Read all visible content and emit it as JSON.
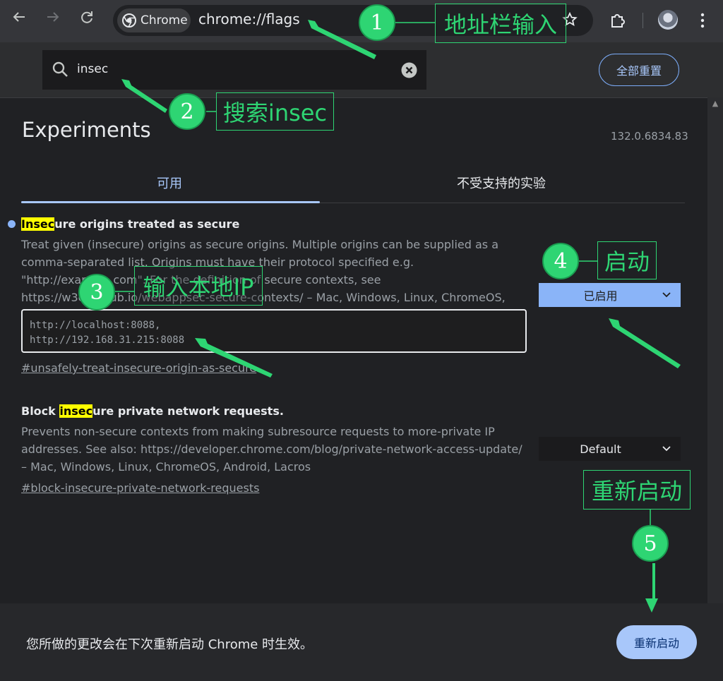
{
  "browser": {
    "chip_label": "Chrome",
    "url": "chrome://flags"
  },
  "search": {
    "query": "insec"
  },
  "header": {
    "reset_label": "全部重置"
  },
  "main": {
    "title": "Experiments",
    "version": "132.0.6834.83",
    "tabs": [
      {
        "label": "可用"
      },
      {
        "label": "不受支持的实验"
      }
    ]
  },
  "flags": [
    {
      "title_highlight": "Insec",
      "title_rest": "ure origins treated as secure",
      "description": "Treat given (insecure) origins as secure origins. Multiple origins can be supplied as a comma-separated list. Origins must have their protocol specified e.g. \"http://example.com\". For the definition of secure contexts, see https://w3c.github.io/webappsec-secure-contexts/ – Mac, Windows, Linux, ChromeOS, Android, Lacros",
      "textarea_value": "http://localhost:8088,\nhttp://192.168.31.215:8088",
      "link": "#unsafely-treat-insecure-origin-as-secure",
      "select_value": "已启用"
    },
    {
      "title_pre": "Block ",
      "title_highlight": "insec",
      "title_rest": "ure private network requests.",
      "description": "Prevents non-secure contexts from making subresource requests to more-private IP addresses. See also: https://developer.chrome.com/blog/private-network-access-update/ – Mac, Windows, Linux, ChromeOS, Android, Lacros",
      "link": "#block-insecure-private-network-requests",
      "select_value": "Default"
    }
  ],
  "footer": {
    "message": "您所做的更改会在下次重新启动 Chrome 时生效。",
    "relaunch_label": "重新启动"
  },
  "annotations": [
    {
      "number": "1",
      "label": "地址栏输入"
    },
    {
      "number": "2",
      "label": "搜索insec"
    },
    {
      "number": "3",
      "label": "输入本地IP"
    },
    {
      "number": "4",
      "label": "启动"
    },
    {
      "number": "5",
      "label": "重新启动"
    }
  ],
  "icons": {
    "back": "arrow-left",
    "forward": "arrow-right",
    "reload": "reload",
    "star": "star",
    "extensions": "puzzle",
    "menu": "kebab",
    "search": "magnifier",
    "clear": "circle-x",
    "chevron": "chevron-down"
  },
  "colors": {
    "accent": "#a8c7fa",
    "annotation": "#2ed573",
    "highlight": "#ffff00"
  }
}
